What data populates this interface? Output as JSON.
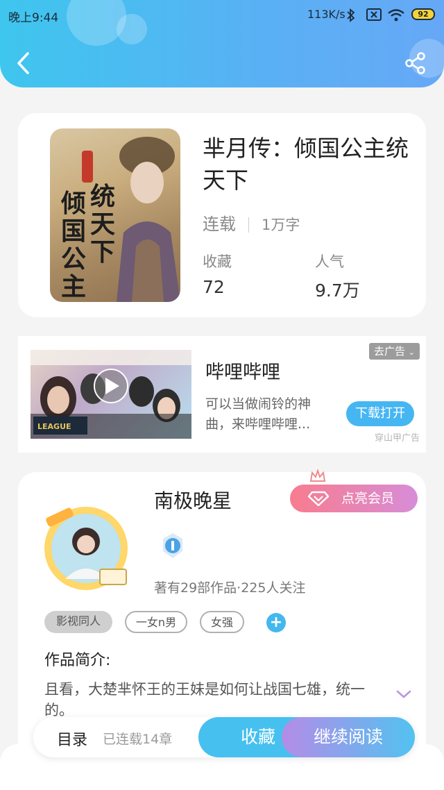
{
  "status_bar": {
    "time": "晚上9:44",
    "net_speed": "113K/s",
    "battery": "92"
  },
  "book": {
    "title": "芈月传：倾国公主统天下",
    "status": "连载",
    "word_count": "1万字",
    "favorites_label": "收藏",
    "favorites_value": "72",
    "popularity_label": "人气",
    "popularity_value": "9.7万"
  },
  "ad": {
    "title": "哔哩哔哩",
    "description": "可以当做闹铃的神曲，来哔哩哔哩...",
    "close_tag": "去广告",
    "button": "下载打开",
    "source": "穿山甲广告"
  },
  "author": {
    "name": "南极晚星",
    "vip_button": "点亮会员",
    "info": "著有29部作品·225人关注",
    "tags": [
      "影视同人",
      "一女n男",
      "女强"
    ],
    "intro_label": "作品简介:",
    "intro_text": "且看，大楚芈怀王的王妹是如何让战国七雄，统一的。"
  },
  "bottom_bar": {
    "toc": "目录",
    "serial_status": "已连载14章",
    "collect_button": "收藏",
    "read_button": "继续阅读"
  },
  "colors": {
    "header_start": "#3ec6ee",
    "header_end": "#66a8f6",
    "accent_blue": "#45b6f2",
    "vip_pink": "#f87c8e",
    "read_purple": "#b48ce8"
  }
}
